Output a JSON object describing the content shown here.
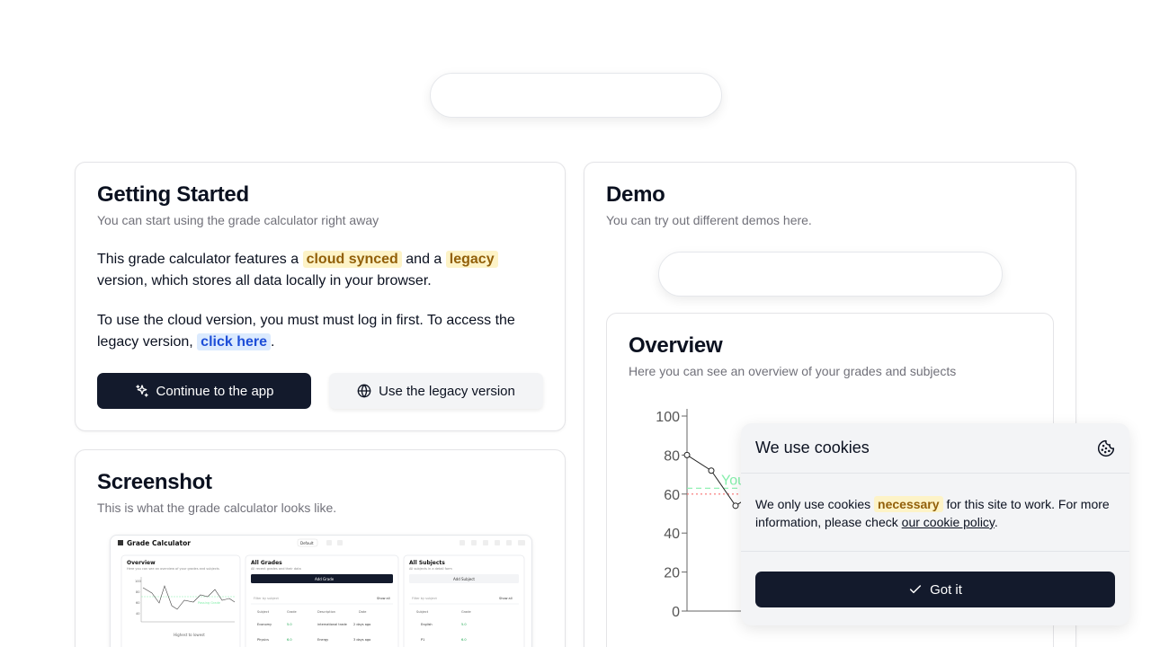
{
  "getting_started": {
    "title": "Getting Started",
    "subtitle": "You can start using the grade calculator right away",
    "p1_before": "This grade calculator features a",
    "p1_hl1": "cloud synced",
    "p1_mid": "and a",
    "p1_hl2": "legacy",
    "p1_after": "version, which stores all data locally in your browser.",
    "p2_before": "To use the cloud version, you must must log in first. To access the legacy version,",
    "p2_link": "click here",
    "p2_after": ".",
    "btn_continue": "Continue to the app",
    "btn_legacy": "Use the legacy version"
  },
  "screenshot": {
    "title": "Screenshot",
    "subtitle": "This is what the grade calculator looks like.",
    "preview": {
      "app_name": "Grade Calculator",
      "preset": "Default",
      "overview_title": "Overview",
      "overview_sub": "Here you can see an overview of your grades and subjects",
      "grades_title": "All Grades",
      "grades_sub": "All recent grades and their data",
      "add_grade": "Add Grade",
      "filter_subject": "Filter by subject",
      "show_all": "Show all",
      "grades_cols": [
        "Subject",
        "Grade",
        "Description",
        "Date"
      ],
      "grades_rows": [
        [
          "Economy",
          "5.0",
          "international trade",
          "2 days ago"
        ],
        [
          "Physics",
          "6.0",
          "Energy",
          "3 days ago"
        ]
      ],
      "subjects_title": "All Subjects",
      "subjects_sub": "All subjects in a detail form",
      "add_subject": "Add Subject",
      "subjects_cols": [
        "Subject",
        "Grade"
      ],
      "subjects_rows": [
        [
          "English",
          "5.0"
        ],
        [
          "P1",
          "6.0"
        ]
      ],
      "chart_xlabel": "Highest to lowest",
      "chart_passing": "Passing Grade"
    }
  },
  "demo": {
    "title": "Demo",
    "subtitle": "You can try out different demos here.",
    "overview_title": "Overview",
    "overview_subtitle": "Here you can see an overview of your grades and subjects",
    "chart_visible_label": "You"
  },
  "chart_data": {
    "type": "line",
    "title": "",
    "xlabel": "",
    "ylabel": "",
    "ylim": [
      0,
      100
    ],
    "yticks": [
      0,
      20,
      40,
      60,
      80,
      100
    ],
    "series": [
      {
        "values": [
          80,
          72,
          54,
          62
        ]
      }
    ],
    "reference_lines": [
      {
        "value": 63,
        "style": "dashed",
        "color": "#86efac",
        "label": "You"
      },
      {
        "value": 60,
        "style": "dotted",
        "color": "#f87171"
      }
    ],
    "grid": false
  },
  "cookie": {
    "title": "We use cookies",
    "body_before": "We only use cookies",
    "body_hl": "necessary",
    "body_mid": "for this site to work. For more information, please check",
    "body_link": "our cookie policy",
    "body_after": ".",
    "button": "Got it"
  },
  "colors": {
    "primary": "#131a2c",
    "highlight_yellow_bg": "#fdf3c7",
    "highlight_yellow_fg": "#92600a",
    "highlight_blue_bg": "#dbeafe",
    "highlight_blue_fg": "#1d4ed8"
  }
}
